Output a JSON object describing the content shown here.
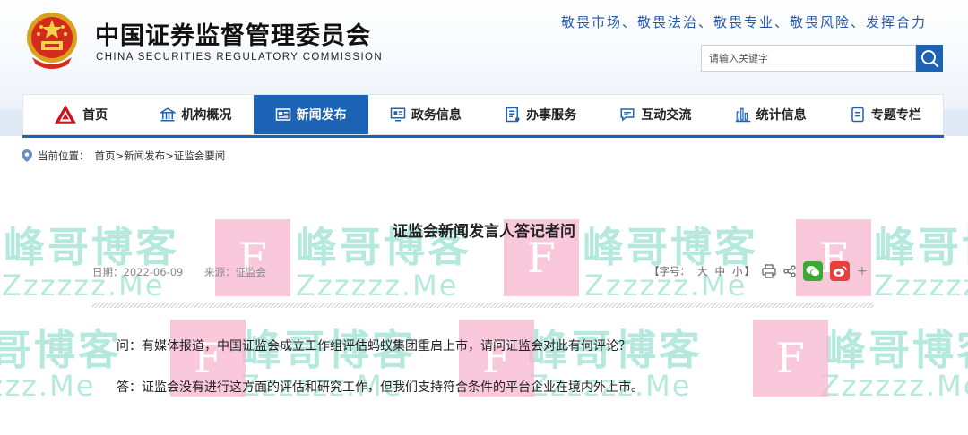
{
  "header": {
    "title_cn": "中国证券监督管理委员会",
    "title_en": "CHINA SECURITIES REGULATORY COMMISSION",
    "slogan": "敬畏市场、敬畏法治、敬畏专业、敬畏风险、发挥合力",
    "search_placeholder": "请输入关键字"
  },
  "nav": {
    "items": [
      {
        "label": "首页",
        "icon": "home-logo-icon"
      },
      {
        "label": "机构概况",
        "icon": "building-icon"
      },
      {
        "label": "新闻发布",
        "icon": "newspaper-icon",
        "active": true
      },
      {
        "label": "政务信息",
        "icon": "monitor-icon"
      },
      {
        "label": "办事服务",
        "icon": "document-icon"
      },
      {
        "label": "互动交流",
        "icon": "chat-icon"
      },
      {
        "label": "统计信息",
        "icon": "bar-chart-icon"
      },
      {
        "label": "专题专栏",
        "icon": "list-icon"
      }
    ]
  },
  "breadcrumb": {
    "prefix": "当前位置：",
    "path": "首页>新闻发布>证监会要闻"
  },
  "article": {
    "title": "证监会新闻发言人答记者问",
    "date_label": "日期：",
    "date": "2022-06-09",
    "source_label": "来源：",
    "source": "证监会",
    "font_size_label": "【字号：",
    "font_large": "大",
    "font_medium": "中",
    "font_small": "小",
    "font_close": "】",
    "plus": "+",
    "question": "问：有媒体报道，中国证监会成立工作组评估蚂蚁集团重启上市，请问证监会对此有何评论？",
    "answer": "答：证监会没有进行这方面的评估和研究工作，但我们支持符合条件的平台企业在境内外上市。"
  },
  "watermark": {
    "text": "峰哥博客",
    "sub": "Zzzzzz.Me",
    "box": "F"
  },
  "colors": {
    "brand_blue": "#1c63b6",
    "slogan_blue": "#2558a8",
    "watermark_green": "#5fd0b8",
    "watermark_pink": "#f9b6cf"
  }
}
